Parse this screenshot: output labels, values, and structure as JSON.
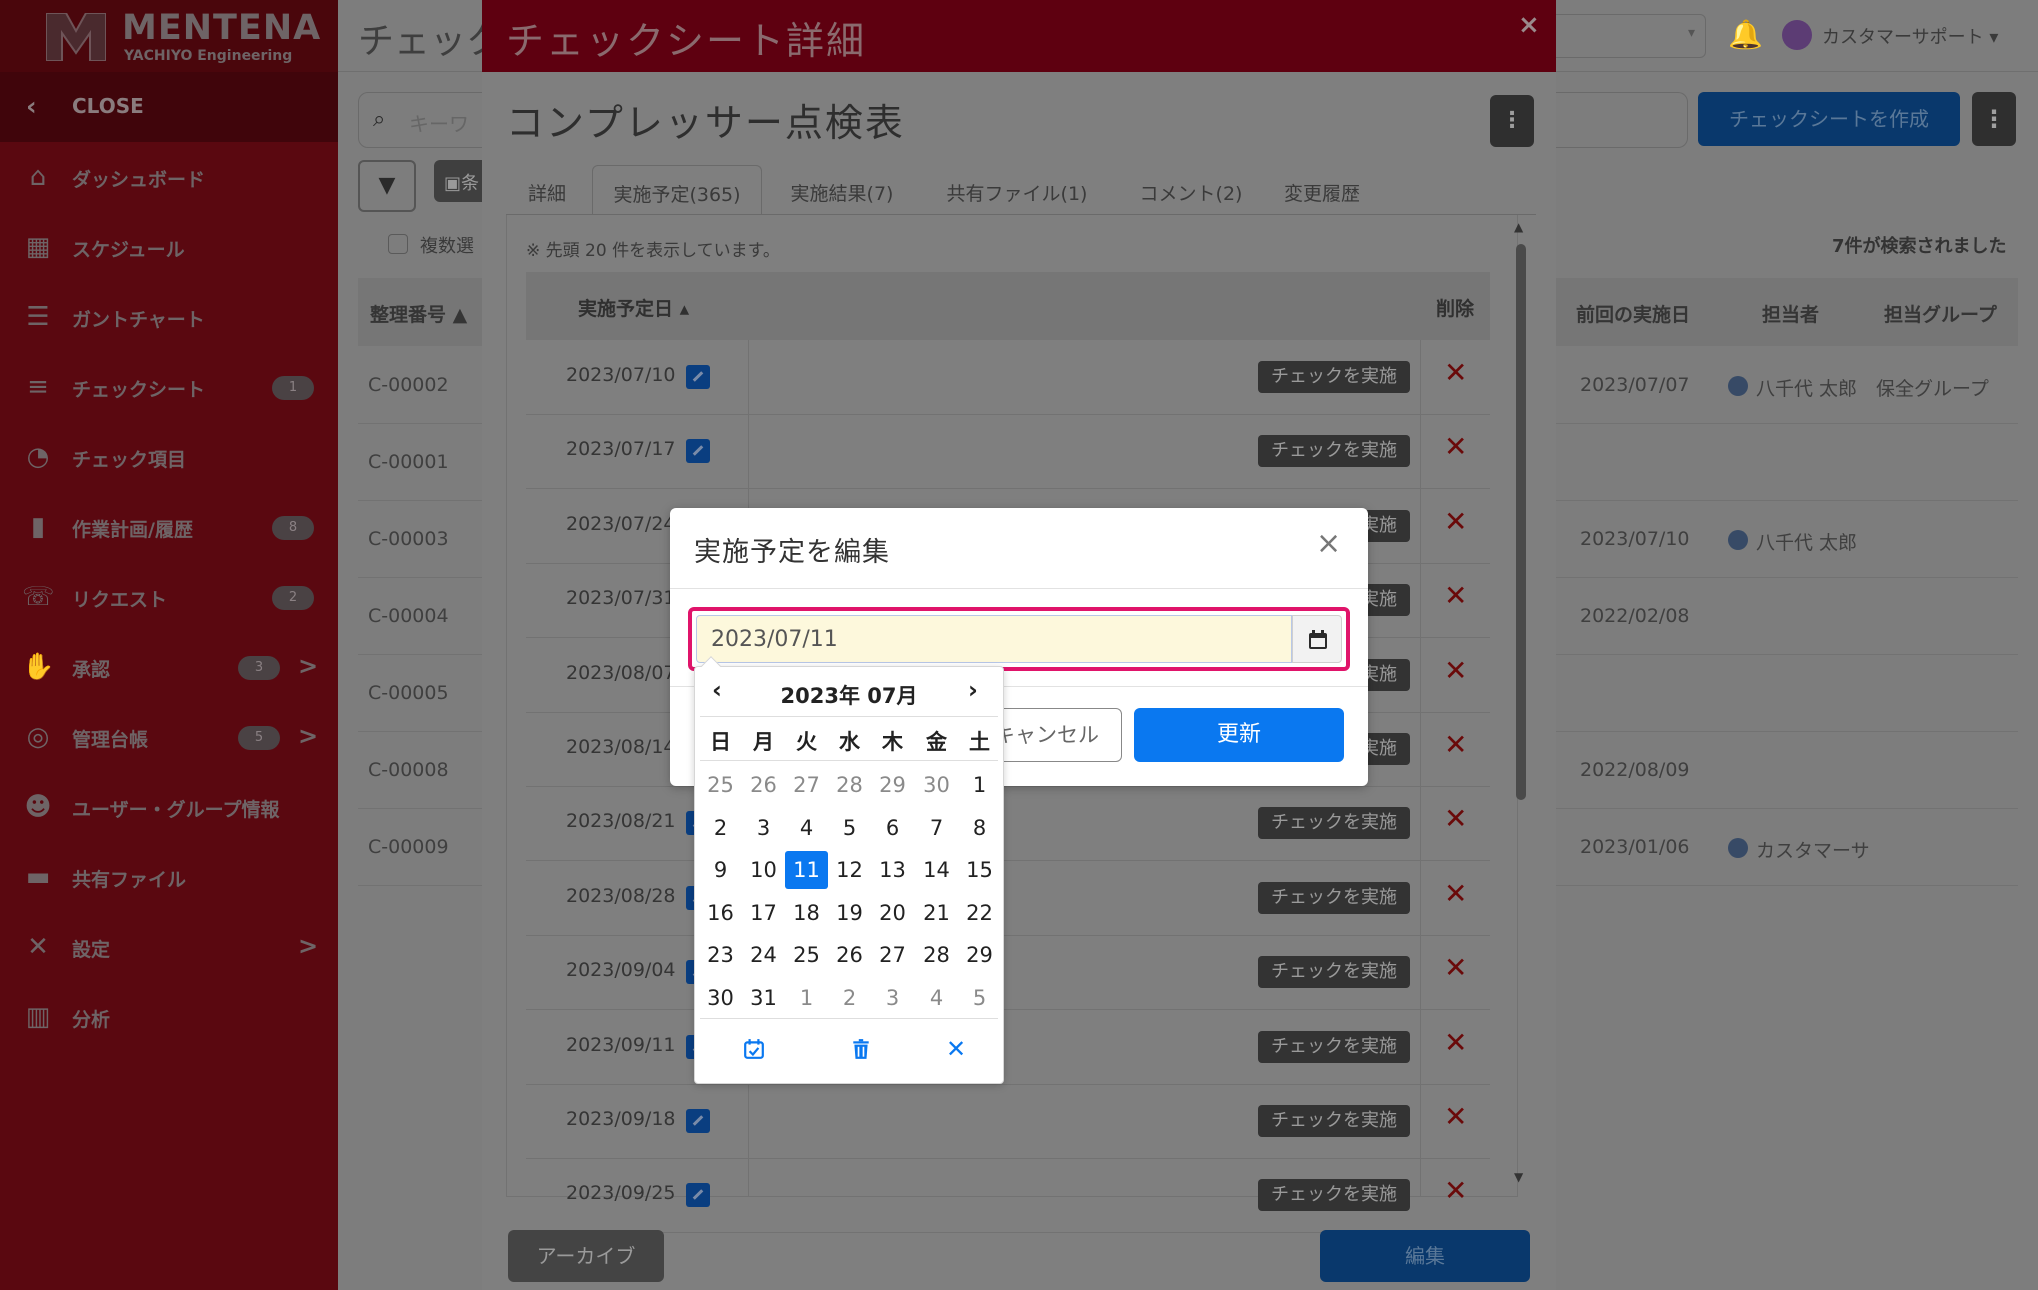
{
  "app": {
    "logo_name": "MENTENA",
    "logo_sub": "YACHIYO Engineering",
    "colors": {
      "sidebar": "#5a0810",
      "modal_header": "#5e0010",
      "primary": "#0a78f0",
      "highlight": "#e0146a",
      "input_bg": "#fdf8dc"
    }
  },
  "sidebar": {
    "close_label": "CLOSE",
    "items": [
      {
        "label": "ダッシュボード",
        "icon": "home-icon",
        "glyph": "⌂"
      },
      {
        "label": "スケジュール",
        "icon": "calendar-icon",
        "glyph": "▦"
      },
      {
        "label": "ガントチャート",
        "icon": "gantt-icon",
        "glyph": "☰"
      },
      {
        "label": "チェックシート",
        "icon": "checklist-icon",
        "glyph": "≡",
        "badge": "1"
      },
      {
        "label": "チェック項目",
        "icon": "gauge-icon",
        "glyph": "◔"
      },
      {
        "label": "作業計画/履歴",
        "icon": "clipboard-icon",
        "glyph": "▮",
        "badge": "8"
      },
      {
        "label": "リクエスト",
        "icon": "phone-icon",
        "glyph": "☏",
        "badge": "2"
      },
      {
        "label": "承認",
        "icon": "thumbs-up-icon",
        "glyph": "✋",
        "badge": "3",
        "arrow": ">"
      },
      {
        "label": "管理台帳",
        "icon": "database-icon",
        "glyph": "◎",
        "badge": "5",
        "arrow": ">"
      },
      {
        "label": "ユーザー・グループ情報",
        "icon": "users-icon",
        "glyph": "☻"
      },
      {
        "label": "共有ファイル",
        "icon": "folder-icon",
        "glyph": "▬"
      },
      {
        "label": "設定",
        "icon": "tools-icon",
        "glyph": "✕",
        "arrow": ">"
      },
      {
        "label": "分析",
        "icon": "chart-icon",
        "glyph": "▥"
      }
    ]
  },
  "background": {
    "page_title": "チェック",
    "user_name": "カスタマーサポート",
    "search_placeholder": "キーワ",
    "create_button": "チェックシートを作成",
    "save_condition": "条",
    "multi_select": "複数選",
    "result_count": "7件が検索されました",
    "headers": {
      "id": "整理番号",
      "last_date": "前回の実施日",
      "assignee": "担当者",
      "group": "担当グループ"
    },
    "rows": [
      {
        "id": "C-00002",
        "last_date": "2023/07/07",
        "assignee": "八千代 太郎",
        "group": "保全グループ"
      },
      {
        "id": "C-00001",
        "last_date": "",
        "assignee": "",
        "group": ""
      },
      {
        "id": "C-00003",
        "last_date": "2023/07/10",
        "assignee": "八千代 太郎",
        "group": ""
      },
      {
        "id": "C-00004",
        "last_date": "2022/02/08",
        "assignee": "",
        "group": ""
      },
      {
        "id": "C-00005",
        "last_date": "",
        "assignee": "",
        "group": ""
      },
      {
        "id": "C-00008",
        "last_date": "2022/08/09",
        "assignee": "",
        "group": ""
      },
      {
        "id": "C-00009",
        "last_date": "2023/01/06",
        "assignee": "カスタマーサ",
        "group": ""
      }
    ]
  },
  "modal": {
    "title": "チェックシート詳細",
    "close": "×",
    "sheet_title": "コンプレッサー点検表",
    "tabs": [
      "詳細",
      "実施予定(365)",
      "実施結果(7)",
      "共有ファイル(1)",
      "コメント(2)",
      "変更履歴"
    ],
    "active_tab": 1,
    "notice": "※ 先頭 20 件を表示しています。",
    "col_date": "実施予定日",
    "col_delete": "削除",
    "check_button": "チェックを実施",
    "delete_mark": "✕",
    "dates": [
      "2023/07/10",
      "2023/07/17",
      "2023/07/24",
      "2023/07/31",
      "2023/08/07",
      "2023/08/14",
      "2023/08/21",
      "2023/08/28",
      "2023/09/04",
      "2023/09/11",
      "2023/09/18",
      "2023/09/25"
    ],
    "archive_button": "アーカイブ",
    "edit_button": "編集"
  },
  "dialog": {
    "title": "実施予定を編集",
    "date_value": "2023/07/11",
    "cancel": "キャンセル",
    "update": "更新"
  },
  "datepicker": {
    "title": "2023年 07月",
    "dow": [
      "日",
      "月",
      "火",
      "水",
      "木",
      "金",
      "土"
    ],
    "weeks": [
      [
        "25",
        "26",
        "27",
        "28",
        "29",
        "30",
        "1"
      ],
      [
        "2",
        "3",
        "4",
        "5",
        "6",
        "7",
        "8"
      ],
      [
        "9",
        "10",
        "11",
        "12",
        "13",
        "14",
        "15"
      ],
      [
        "16",
        "17",
        "18",
        "19",
        "20",
        "21",
        "22"
      ],
      [
        "23",
        "24",
        "25",
        "26",
        "27",
        "28",
        "29"
      ],
      [
        "30",
        "31",
        "1",
        "2",
        "3",
        "4",
        "5"
      ]
    ],
    "selected": "11",
    "actions": [
      "today-icon",
      "trash-icon",
      "close-icon"
    ],
    "close_mark": "✕"
  }
}
